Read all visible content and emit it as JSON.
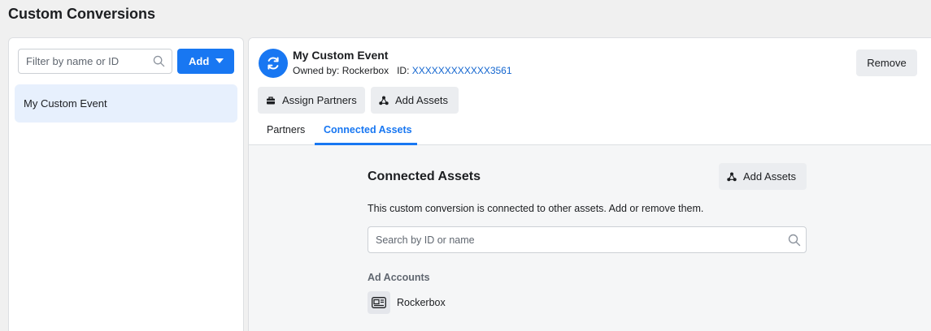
{
  "page": {
    "title": "Custom Conversions"
  },
  "sidebar": {
    "filter_placeholder": "Filter by name or ID",
    "add_label": "Add",
    "items": [
      {
        "label": "My Custom Event",
        "selected": true
      }
    ]
  },
  "detail": {
    "event_name": "My Custom Event",
    "owner_label": "Owned by:",
    "owner_name": "Rockerbox",
    "id_label": "ID:",
    "id_value": "XXXXXXXXXXXX3561",
    "remove_label": "Remove",
    "assign_partners_label": "Assign Partners",
    "add_assets_label": "Add Assets",
    "tabs": [
      {
        "label": "Partners",
        "active": false
      },
      {
        "label": "Connected Assets",
        "active": true
      }
    ]
  },
  "connected_assets": {
    "heading": "Connected Assets",
    "add_assets_label": "Add Assets",
    "description": "This custom conversion is connected to other assets. Add or remove them.",
    "search_placeholder": "Search by ID or name",
    "section_label": "Ad Accounts",
    "accounts": [
      {
        "name": "Rockerbox"
      }
    ]
  },
  "colors": {
    "accent": "#1877f2",
    "selected_bg": "#e7f0fd",
    "link": "#1265cf",
    "button_gray": "#ebedf0"
  },
  "icons": {
    "event_avatar": "refresh-icon",
    "filter_search": "search-icon",
    "add_caret": "caret-down-icon",
    "assign_partners": "briefcase-icon",
    "add_assets": "assets-icon",
    "asset_search": "search-icon",
    "ad_account": "ad-account-icon"
  }
}
